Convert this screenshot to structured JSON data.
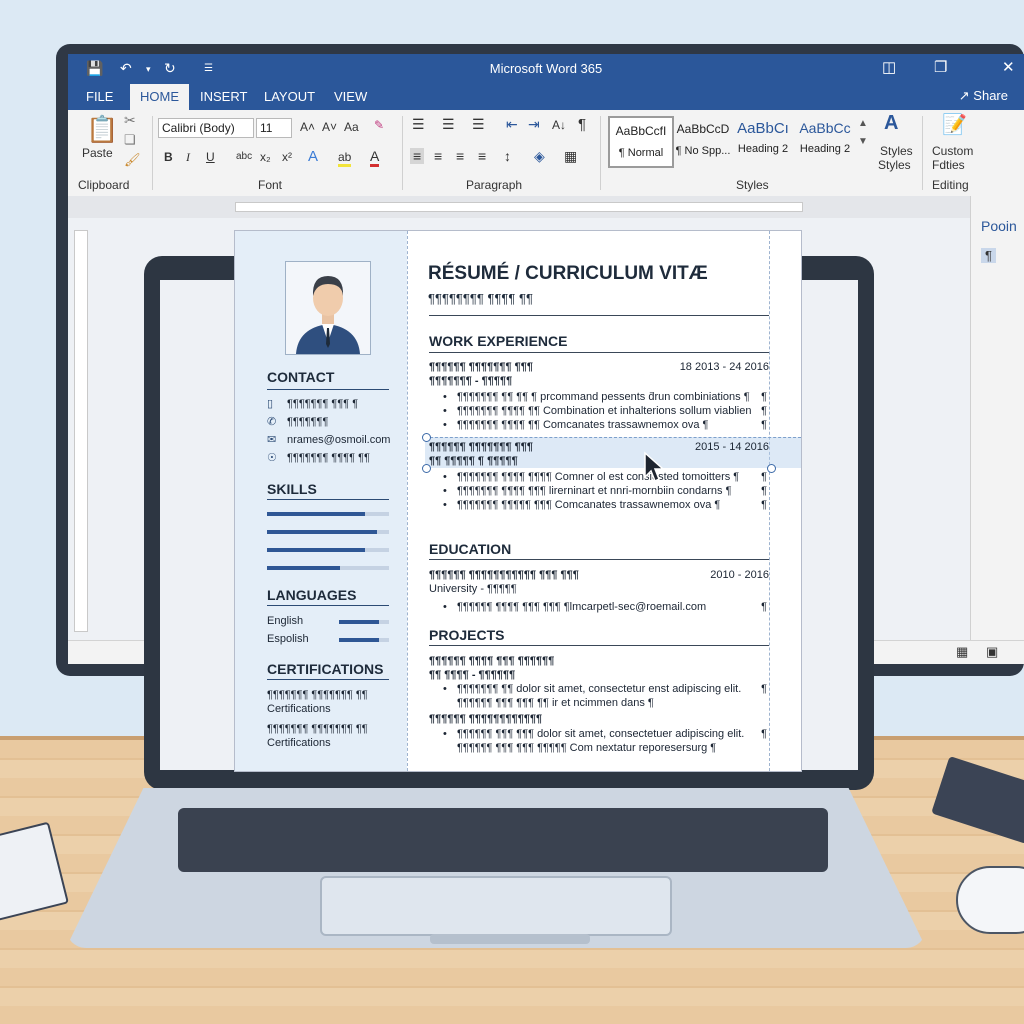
{
  "app": {
    "title": "Microsoft Word 365",
    "tabs": [
      {
        "label": "FILE",
        "active": false
      },
      {
        "label": "HOME",
        "active": true
      },
      {
        "label": "INSERT",
        "active": false
      },
      {
        "label": "LAYOUT",
        "active": false
      },
      {
        "label": "VIEW",
        "active": false
      }
    ],
    "share_label": "Share",
    "accent_color": "#2b579a"
  },
  "ribbon": {
    "clipboard": {
      "paste_label": "Paste",
      "group_label": "Clipboard"
    },
    "font": {
      "family_value": "Calibri (Body)",
      "size_value": "11",
      "change_case": "Aa",
      "group_label": "Font",
      "bold": "B",
      "italic": "I",
      "underline": "U",
      "strike": "abc",
      "sub": "x₂",
      "sup": "x²",
      "effects": "A",
      "highlight": "ab",
      "color": "A",
      "grow": "A˄",
      "shrink": "A˅"
    },
    "paragraph": {
      "group_label": "Paragraph",
      "sort": "A↓",
      "pilcrow": "¶"
    },
    "styles": {
      "group_label": "Styles",
      "tiles": [
        {
          "preview": "AaBbCcfI",
          "name": "¶ Normal",
          "selected": true
        },
        {
          "preview": "AaBbCcD",
          "name": "¶ No Spp...",
          "selected": false
        },
        {
          "preview": "AaBbCı",
          "name": "Heading 2",
          "selected": false
        },
        {
          "preview": "AaBbCc",
          "name": "Heading 2",
          "selected": false
        }
      ],
      "styles_btn": "Styles",
      "styles_btn_line2": "Styles"
    },
    "editing": {
      "custom_line1": "Custom",
      "custom_line2": "Fdties",
      "group_label": "Editing"
    }
  },
  "right_pane": {
    "title": "Pooin",
    "pilcrow": "¶"
  },
  "resume": {
    "title": "RÉSUMÉ / CURRICULUM VITÆ",
    "subtitle": "¶¶¶¶¶¶¶¶ ¶¶¶¶ ¶¶",
    "contact": {
      "heading": "CONTACT",
      "phone": "¶¶¶¶¶¶¶ ¶¶¶ ¶",
      "mobile": "¶¶¶¶¶¶¶",
      "email": "nrames@osmo⁠il.com",
      "web": "¶¶¶¶¶¶¶ ¶¶¶¶ ¶¶"
    },
    "skills": {
      "heading": "SKILLS",
      "levels": [
        0.8,
        0.9,
        0.8,
        0.6
      ]
    },
    "languages": {
      "heading": "LANGUAGES",
      "items": [
        {
          "name": "English",
          "level": 0.8
        },
        {
          "name": "Espolish",
          "level": 0.8
        }
      ]
    },
    "certifications": {
      "heading": "CERTIFICATIONS",
      "items": [
        {
          "line1": "¶¶¶¶¶¶¶ ¶¶¶¶¶¶¶ ¶¶",
          "line2": "Certifications"
        },
        {
          "line1": "¶¶¶¶¶¶¶ ¶¶¶¶¶¶¶ ¶¶",
          "line2": "Certifications"
        }
      ]
    },
    "work": {
      "heading": "WORK EXPERIENCE",
      "jobs": [
        {
          "title": "¶¶¶¶¶¶ ¶¶¶¶¶¶¶ ¶¶¶",
          "date": "18 2013 - 24 2016",
          "company": "¶¶¶¶¶¶¶ - ¶¶¶¶¶",
          "bullets": [
            "¶¶¶¶¶¶¶ ¶¶ ¶¶ ¶ prcommand pessents d̄run combiniations ¶",
            "¶¶¶¶¶¶¶ ¶¶¶¶ ¶¶ Combination et inhalterions sollum viablien",
            "¶¶¶¶¶¶¶ ¶¶¶¶ ¶¶ Comcanates trassawnemox ova ¶"
          ]
        },
        {
          "title": "¶¶¶¶¶¶ ¶¶¶¶¶¶¶ ¶¶¶",
          "date": "2015 - 14 2016",
          "company": "¶¶ ¶¶¶¶¶ ¶ ¶¶¶¶¶",
          "bullets": [
            "¶¶¶¶¶¶¶ ¶¶¶¶ ¶¶¶¶ Comner ol est consiested tomoitters ¶",
            "¶¶¶¶¶¶¶ ¶¶¶¶ ¶¶¶ lirerninart et nnri-mornbiin condarns ¶",
            "¶¶¶¶¶¶¶ ¶¶¶¶¶ ¶¶¶ Comcanates trassawnemox ova ¶"
          ]
        }
      ]
    },
    "education": {
      "heading": "EDUCATION",
      "degree": "¶¶¶¶¶¶ ¶¶¶¶¶¶¶¶¶¶¶ ¶¶¶ ¶¶¶",
      "date": "2010 - 2016",
      "school": "University - ¶¶¶¶¶",
      "bullet": "¶¶¶¶¶¶ ¶¶¶¶ ¶¶¶ ¶¶¶ ¶lmcarpetl-sec@roemail.com"
    },
    "projects": {
      "heading": "PROJECTS",
      "items": [
        {
          "title": "¶¶¶¶¶¶ ¶¶¶¶ ¶¶¶ ¶¶¶¶¶¶",
          "sub": "¶¶ ¶¶¶¶ - ¶¶¶¶¶¶",
          "bullet1": "¶¶¶¶¶¶¶ ¶¶ dolor sit amet, consectetur enst adipiscing elit.",
          "bullet2": "¶¶¶¶¶¶ ¶¶¶ ¶¶¶ ¶¶ ir et ncimmen dans ¶"
        },
        {
          "title": "¶¶¶¶¶¶ ¶¶¶¶¶¶¶¶¶¶¶¶",
          "bullet1": "¶¶¶¶¶¶ ¶¶¶ ¶¶¶ dolor sit amet, consectetuer adipiscing elit.",
          "bullet2": "¶¶¶¶¶¶ ¶¶¶ ¶¶¶ ¶¶¶¶¶ Com nextatur reporesersurg ¶"
        }
      ]
    }
  }
}
